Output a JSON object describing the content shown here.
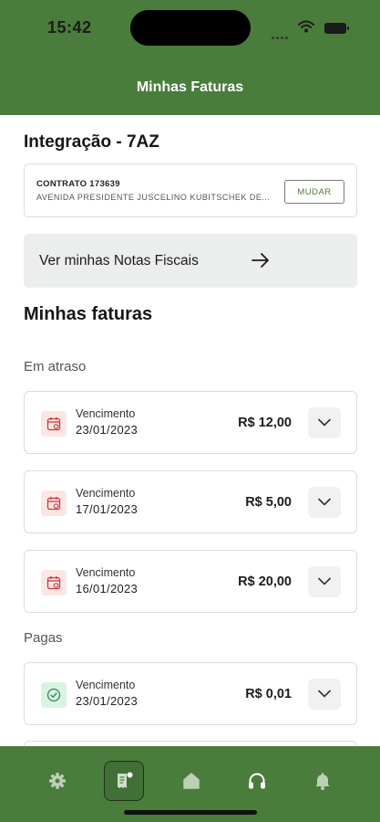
{
  "status_bar": {
    "time": "15:42"
  },
  "header": {
    "title": "Minhas Faturas"
  },
  "integration": {
    "title": "Integração - 7AZ"
  },
  "contract": {
    "number": "CONTRATO 173639",
    "address": "AVENIDA PRESIDENTE JUSCELINO KUBITSCHEK DE...",
    "change_label": "MUDAR"
  },
  "notas": {
    "label": "Ver minhas Notas Fiscais"
  },
  "invoices": {
    "title": "Minhas faturas",
    "late_label": "Em atraso",
    "paid_label": "Pagas",
    "late": [
      {
        "label": "Vencimento",
        "date": "23/01/2023",
        "value": "R$ 12,00"
      },
      {
        "label": "Vencimento",
        "date": "17/01/2023",
        "value": "R$ 5,00"
      },
      {
        "label": "Vencimento",
        "date": "16/01/2023",
        "value": "R$ 20,00"
      }
    ],
    "paid": [
      {
        "label": "Vencimento",
        "date": "23/01/2023",
        "value": "R$ 0,01"
      }
    ]
  },
  "tabbar": {
    "items": [
      {
        "icon": "gear-icon",
        "active": false
      },
      {
        "icon": "receipt-icon",
        "active": true
      },
      {
        "icon": "home-icon",
        "active": false
      },
      {
        "icon": "headphones-icon",
        "active": false
      },
      {
        "icon": "bell-icon",
        "active": false
      }
    ]
  },
  "colors": {
    "primary": "#4a7c3c",
    "late_bg": "#fbe6e6",
    "late_icon": "#c93b3b",
    "paid_bg": "#d9f3e3",
    "paid_icon": "#2f8a56"
  }
}
